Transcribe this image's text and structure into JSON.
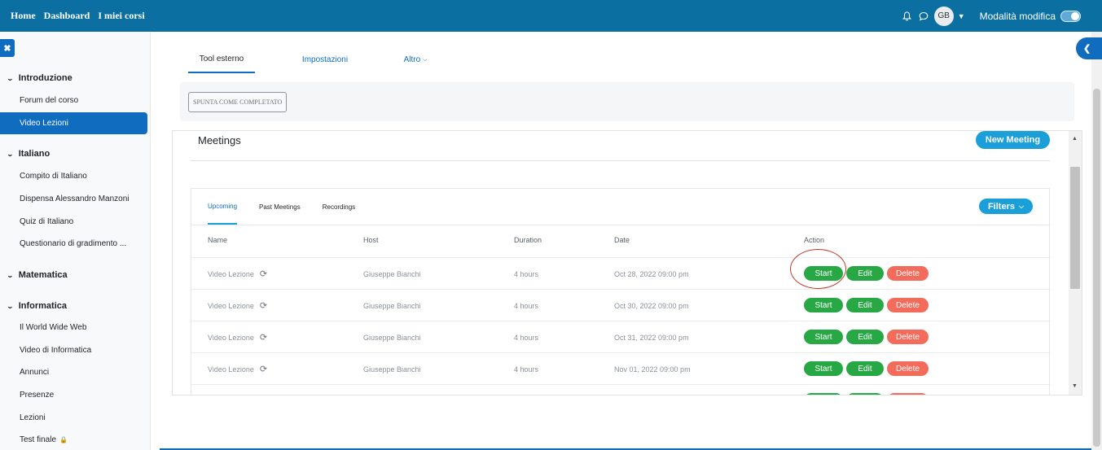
{
  "navbar": {
    "links": [
      "Home",
      "Dashboard",
      "I miei corsi"
    ],
    "avatar_initials": "GB",
    "edit_mode_label": "Modalità modifica",
    "edit_mode_on": true
  },
  "sidebar": {
    "sections": [
      {
        "title": "Introduzione",
        "items": [
          "Forum del corso",
          "Video Lezioni"
        ]
      },
      {
        "title": "Italiano",
        "items": [
          "Compito di Italiano",
          "Dispensa Alessandro Manzoni",
          "Quiz di Italiano",
          "Questionario di gradimento ..."
        ]
      },
      {
        "title": "Matematica",
        "items": []
      },
      {
        "title": "Informatica",
        "items": [
          "Il World Wide Web",
          "Video di Informatica",
          "Annunci",
          "Presenze",
          "Lezioni",
          "Test finale"
        ]
      }
    ],
    "active_item": "Video Lezioni"
  },
  "activity_tabs": [
    "Tool esterno",
    "Impostazioni",
    "Altro"
  ],
  "completion_button": "SPUNTA COME COMPLETATO",
  "meetings": {
    "title": "Meetings",
    "new_button": "New Meeting",
    "subtabs": [
      "Upcoming",
      "Past Meetings",
      "Recordings"
    ],
    "filters_button": "Filters",
    "columns": [
      "Name",
      "Host",
      "Duration",
      "Date",
      "Action"
    ],
    "rows": [
      {
        "name": "Video Lezione",
        "host": "Giuseppe Bianchi",
        "duration": "4 hours",
        "date": "Oct 28, 2022 09:00 pm"
      },
      {
        "name": "Video Lezione",
        "host": "Giuseppe Bianchi",
        "duration": "4 hours",
        "date": "Oct 30, 2022 09:00 pm"
      },
      {
        "name": "Video Lezione",
        "host": "Giuseppe Bianchi",
        "duration": "4 hours",
        "date": "Oct 31, 2022 09:00 pm"
      },
      {
        "name": "Video Lezione",
        "host": "Giuseppe Bianchi",
        "duration": "4 hours",
        "date": "Nov 01, 2022 09:00 pm"
      }
    ],
    "actions": {
      "start": "Start",
      "edit": "Edit",
      "delete": "Delete"
    }
  },
  "icons": {
    "bell": "bell-icon",
    "chat": "chat-icon",
    "sync": "sync-icon",
    "lock": "lock-icon"
  },
  "colors": {
    "navbar": "#0b6fa1",
    "primary": "#0f6cbf",
    "accent": "#1a9fd9",
    "success": "#28a745",
    "danger": "#f26b5b"
  }
}
